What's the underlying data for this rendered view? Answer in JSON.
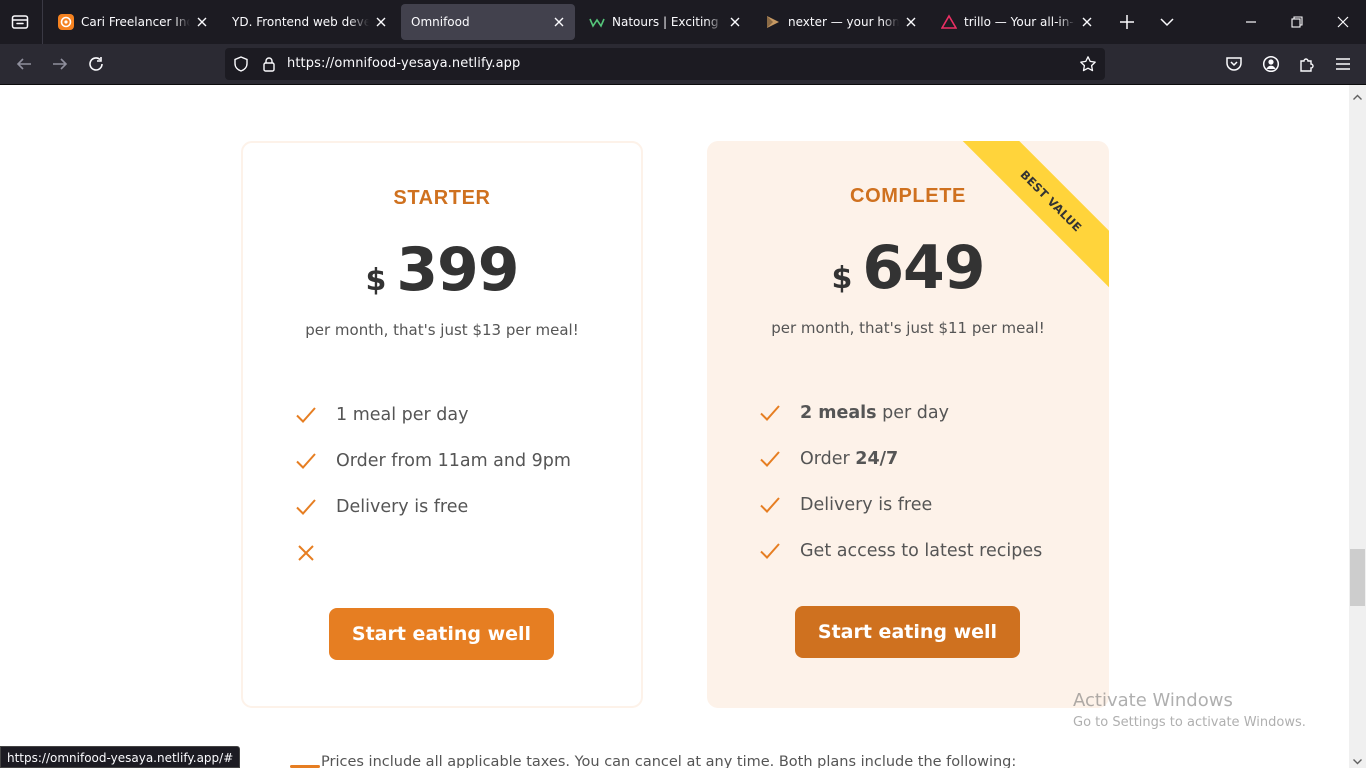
{
  "browser": {
    "tabs": [
      {
        "title": "Cari Freelancer Indonesia",
        "icon": "sribulancer-icon"
      },
      {
        "title": "YD. Frontend web developer",
        "icon": "none"
      },
      {
        "title": "Omnifood",
        "icon": "none",
        "active": true
      },
      {
        "title": "Natours | Exciting tours",
        "icon": "natours-icon"
      },
      {
        "title": "nexter — your home, your freedom",
        "icon": "nexter-icon"
      },
      {
        "title": "trillo — Your all-in-one",
        "icon": "trillo-icon"
      }
    ],
    "url": "https://omnifood-yesaya.netlify.app",
    "status_link": "https://omnifood-yesaya.netlify.app/#"
  },
  "pricing": {
    "starter": {
      "name": "STARTER",
      "currency": "$",
      "price": "399",
      "note": "per month, that's just $13 per meal!",
      "features": [
        {
          "pre": "1 meal per day",
          "bold": "",
          "post": ""
        },
        {
          "pre": "Order from 11am and 9pm",
          "bold": "",
          "post": ""
        },
        {
          "pre": "Delivery is free",
          "bold": "",
          "post": ""
        },
        {
          "pre": "",
          "bold": "",
          "post": "",
          "excluded": true
        }
      ],
      "cta": "Start eating well"
    },
    "complete": {
      "name": "COMPLETE",
      "ribbon": "BEST VALUE",
      "currency": "$",
      "price": "649",
      "note": "per month, that's just $11 per meal!",
      "features": [
        {
          "pre": "",
          "bold": "2 meals",
          "post": " per day"
        },
        {
          "pre": "Order ",
          "bold": "24/7",
          "post": ""
        },
        {
          "pre": "Delivery is free",
          "bold": "",
          "post": ""
        },
        {
          "pre": "Get access to latest recipes",
          "bold": "",
          "post": ""
        }
      ],
      "cta": "Start eating well"
    },
    "bottom_note": "Prices include all applicable taxes. You can cancel at any time. Both plans include the following:"
  },
  "watermark": {
    "line1": "Activate Windows",
    "line2": "Go to Settings to activate Windows."
  },
  "colors": {
    "accent": "#e67e22",
    "accent_dark": "#cf711f",
    "card_tint": "#fdf2e9",
    "ribbon": "#ffd43b",
    "chrome_dark": "#1c1b22",
    "toolbar": "#2b2a33"
  }
}
